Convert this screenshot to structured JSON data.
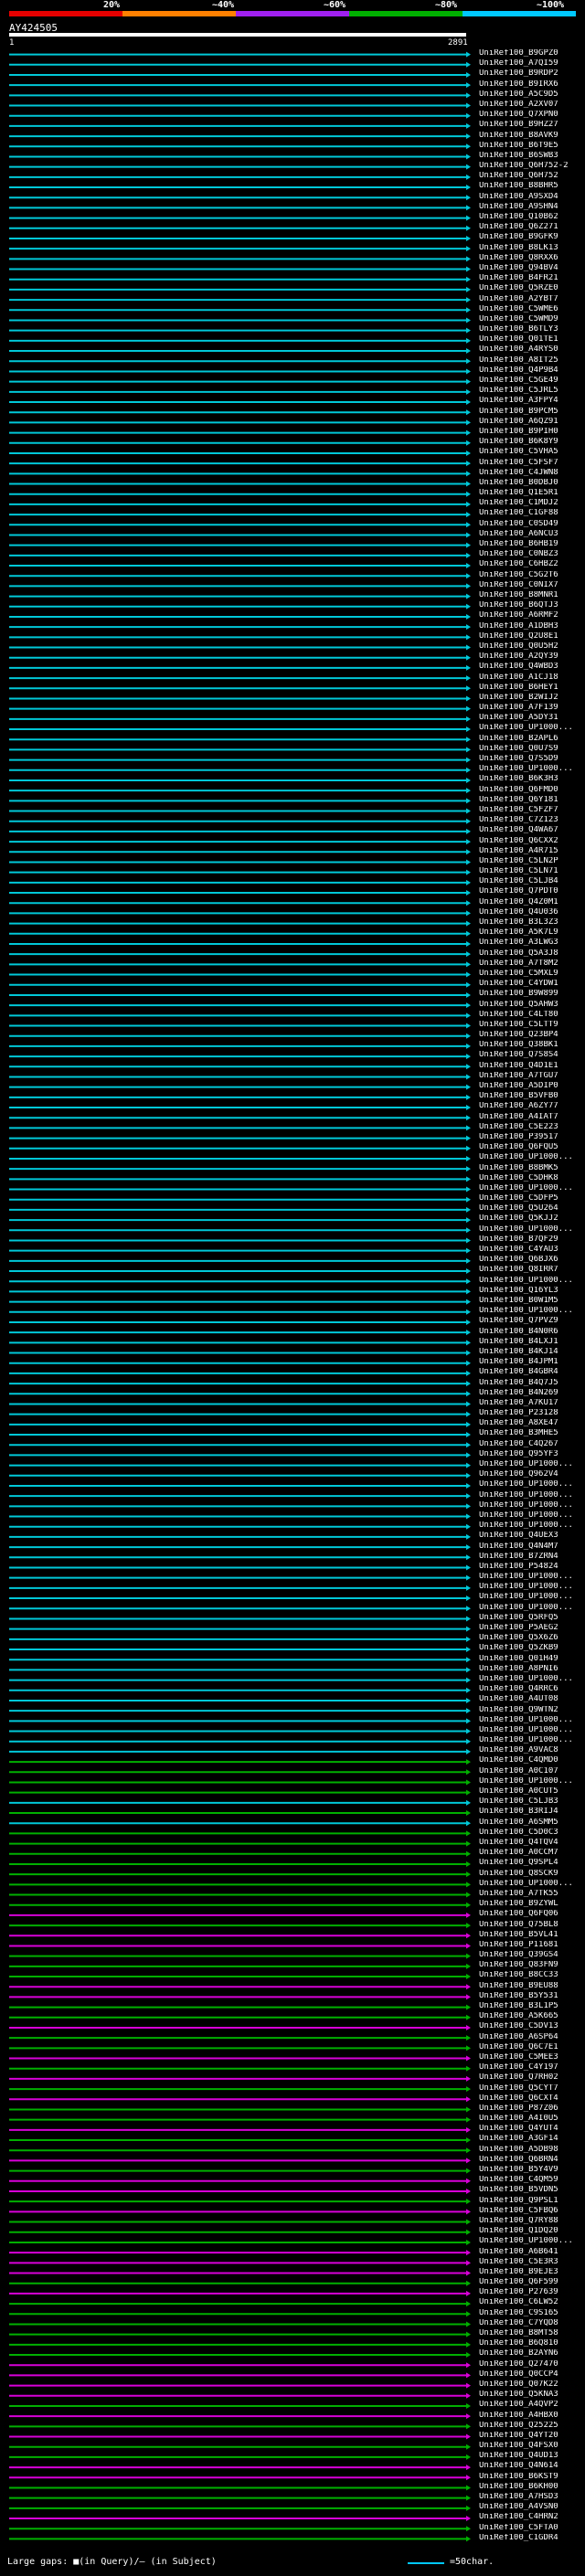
{
  "legend": {
    "percent_labels": [
      "20%",
      "~40%",
      "~60%",
      "~80%",
      "~100%"
    ],
    "colors": [
      "#e60000",
      "#ff8000",
      "#a020f0",
      "#00b000",
      "#00c8ff"
    ]
  },
  "query": {
    "id": "AY424505",
    "ruler_start": "1",
    "ruler_end": "2891"
  },
  "footer": {
    "gaps_text": "Large gaps: ■(in Query)/– (in Subject)",
    "scale_text": "=50char."
  },
  "hit_colors": {
    "cyan": "#00c8d8",
    "green": "#00b000",
    "magenta": "#d800d8"
  },
  "hits": [
    {
      "label": "UniRef100_B9GPZ0",
      "color": "cyan"
    },
    {
      "label": "UniRef100_A7QI59",
      "color": "cyan"
    },
    {
      "label": "UniRef100_B9RDP2",
      "color": "cyan"
    },
    {
      "label": "UniRef100_B9IRX6",
      "color": "cyan"
    },
    {
      "label": "UniRef100_A5C9D5",
      "color": "cyan"
    },
    {
      "label": "UniRef100_A2XV07",
      "color": "cyan"
    },
    {
      "label": "UniRef100_Q7XPN0",
      "color": "cyan"
    },
    {
      "label": "UniRef100_B9HZ27",
      "color": "cyan"
    },
    {
      "label": "UniRef100_B8AVK9",
      "color": "cyan"
    },
    {
      "label": "UniRef100_B6T9E5",
      "color": "cyan"
    },
    {
      "label": "UniRef100_B6SWB3",
      "color": "cyan"
    },
    {
      "label": "UniRef100_Q6H752-2",
      "color": "cyan"
    },
    {
      "label": "UniRef100_Q6H752",
      "color": "cyan"
    },
    {
      "label": "UniRef100_B8BHR5",
      "color": "cyan"
    },
    {
      "label": "UniRef100_A9SXD4",
      "color": "cyan"
    },
    {
      "label": "UniRef100_A9SHN4",
      "color": "cyan"
    },
    {
      "label": "UniRef100_Q10B62",
      "color": "cyan"
    },
    {
      "label": "UniRef100_Q6Z271",
      "color": "cyan"
    },
    {
      "label": "UniRef100_B9GFK9",
      "color": "cyan"
    },
    {
      "label": "UniRef100_B8LK13",
      "color": "cyan"
    },
    {
      "label": "UniRef100_Q8RXX6",
      "color": "cyan"
    },
    {
      "label": "UniRef100_Q94BV4",
      "color": "cyan"
    },
    {
      "label": "UniRef100_B4FR21",
      "color": "cyan"
    },
    {
      "label": "UniRef100_Q5RZE0",
      "color": "cyan"
    },
    {
      "label": "UniRef100_A2YBT7",
      "color": "cyan"
    },
    {
      "label": "UniRef100_C5WME6",
      "color": "cyan"
    },
    {
      "label": "UniRef100_C5WMD9",
      "color": "cyan"
    },
    {
      "label": "UniRef100_B6TLY3",
      "color": "cyan"
    },
    {
      "label": "UniRef100_Q01TE1",
      "color": "cyan"
    },
    {
      "label": "UniRef100_A4RYS0",
      "color": "cyan"
    },
    {
      "label": "UniRef100_A8IT25",
      "color": "cyan"
    },
    {
      "label": "UniRef100_Q4P9B4",
      "color": "cyan"
    },
    {
      "label": "UniRef100_C5GE49",
      "color": "cyan"
    },
    {
      "label": "UniRef100_C5JRL5",
      "color": "cyan"
    },
    {
      "label": "UniRef100_A3FPY4",
      "color": "cyan"
    },
    {
      "label": "UniRef100_B9PCM5",
      "color": "cyan"
    },
    {
      "label": "UniRef100_A6QZ91",
      "color": "cyan"
    },
    {
      "label": "UniRef100_B9PIH0",
      "color": "cyan"
    },
    {
      "label": "UniRef100_B6K8Y9",
      "color": "cyan"
    },
    {
      "label": "UniRef100_C5VHA5",
      "color": "cyan"
    },
    {
      "label": "UniRef100_C5FSF7",
      "color": "cyan"
    },
    {
      "label": "UniRef100_C4JWN8",
      "color": "cyan"
    },
    {
      "label": "UniRef100_B0DBJ0",
      "color": "cyan"
    },
    {
      "label": "UniRef100_Q1E5R1",
      "color": "cyan"
    },
    {
      "label": "UniRef100_C1MDJ2",
      "color": "cyan"
    },
    {
      "label": "UniRef100_C1GF88",
      "color": "cyan"
    },
    {
      "label": "UniRef100_C0SD49",
      "color": "cyan"
    },
    {
      "label": "UniRef100_A6NCU3",
      "color": "cyan"
    },
    {
      "label": "UniRef100_B6HB19",
      "color": "cyan"
    },
    {
      "label": "UniRef100_C0NBZ3",
      "color": "cyan"
    },
    {
      "label": "UniRef100_C6HBZ2",
      "color": "cyan"
    },
    {
      "label": "UniRef100_C5G2T6",
      "color": "cyan"
    },
    {
      "label": "UniRef100_C0NIX7",
      "color": "cyan"
    },
    {
      "label": "UniRef100_B8MNR1",
      "color": "cyan"
    },
    {
      "label": "UniRef100_B6QTJ3",
      "color": "cyan"
    },
    {
      "label": "UniRef100_A6RMF2",
      "color": "cyan"
    },
    {
      "label": "UniRef100_A1DBH3",
      "color": "cyan"
    },
    {
      "label": "UniRef100_Q2U8E1",
      "color": "cyan"
    },
    {
      "label": "UniRef100_Q0U5H2",
      "color": "cyan"
    },
    {
      "label": "UniRef100_A2QY39",
      "color": "cyan"
    },
    {
      "label": "UniRef100_Q4WBD3",
      "color": "cyan"
    },
    {
      "label": "UniRef100_A1CJ18",
      "color": "cyan"
    },
    {
      "label": "UniRef100_B6HEY1",
      "color": "cyan"
    },
    {
      "label": "UniRef100_B2WIJ2",
      "color": "cyan"
    },
    {
      "label": "UniRef100_A7F139",
      "color": "cyan"
    },
    {
      "label": "UniRef100_A5DY31",
      "color": "cyan"
    },
    {
      "label": "UniRef100_UP1000...",
      "color": "cyan"
    },
    {
      "label": "UniRef100_B2APL6",
      "color": "cyan"
    },
    {
      "label": "UniRef100_Q0U7S9",
      "color": "cyan"
    },
    {
      "label": "UniRef100_Q7S5D9",
      "color": "cyan"
    },
    {
      "label": "UniRef100_UP1000...",
      "color": "cyan"
    },
    {
      "label": "UniRef100_B6K3H3",
      "color": "cyan"
    },
    {
      "label": "UniRef100_Q6FMD0",
      "color": "cyan"
    },
    {
      "label": "UniRef100_Q6Y181",
      "color": "cyan"
    },
    {
      "label": "UniRef100_C5FZF7",
      "color": "cyan"
    },
    {
      "label": "UniRef100_C7Z123",
      "color": "cyan"
    },
    {
      "label": "UniRef100_Q4WA67",
      "color": "cyan"
    },
    {
      "label": "UniRef100_Q6CXX2",
      "color": "cyan"
    },
    {
      "label": "UniRef100_A4R715",
      "color": "cyan"
    },
    {
      "label": "UniRef100_C5LN2P",
      "color": "cyan"
    },
    {
      "label": "UniRef100_C5LN71",
      "color": "cyan"
    },
    {
      "label": "UniRef100_C5LJB4",
      "color": "cyan"
    },
    {
      "label": "UniRef100_Q7PDT0",
      "color": "cyan"
    },
    {
      "label": "UniRef100_Q4Z0M1",
      "color": "cyan"
    },
    {
      "label": "UniRef100_Q4U036",
      "color": "cyan"
    },
    {
      "label": "UniRef100_B3L3Z3",
      "color": "cyan"
    },
    {
      "label": "UniRef100_A5K7L9",
      "color": "cyan"
    },
    {
      "label": "UniRef100_A3LWG3",
      "color": "cyan"
    },
    {
      "label": "UniRef100_Q5A3J8",
      "color": "cyan"
    },
    {
      "label": "UniRef100_A7T8M2",
      "color": "cyan"
    },
    {
      "label": "UniRef100_C5MXL9",
      "color": "cyan"
    },
    {
      "label": "UniRef100_C4YDW1",
      "color": "cyan"
    },
    {
      "label": "UniRef100_B9W899",
      "color": "cyan"
    },
    {
      "label": "UniRef100_Q5AHW3",
      "color": "cyan"
    },
    {
      "label": "UniRef100_C4LT80",
      "color": "cyan"
    },
    {
      "label": "UniRef100_C5LTT9",
      "color": "cyan"
    },
    {
      "label": "UniRef100_Q23BP4",
      "color": "cyan"
    },
    {
      "label": "UniRef100_Q38BK1",
      "color": "cyan"
    },
    {
      "label": "UniRef100_Q7S8S4",
      "color": "cyan"
    },
    {
      "label": "UniRef100_Q4D1E1",
      "color": "cyan"
    },
    {
      "label": "UniRef100_A7TGU7",
      "color": "cyan"
    },
    {
      "label": "UniRef100_A5DIP0",
      "color": "cyan"
    },
    {
      "label": "UniRef100_B5VFB0",
      "color": "cyan"
    },
    {
      "label": "UniRef100_A6ZY77",
      "color": "cyan"
    },
    {
      "label": "UniRef100_A4IAT7",
      "color": "cyan"
    },
    {
      "label": "UniRef100_C5E223",
      "color": "cyan"
    },
    {
      "label": "UniRef100_P39517",
      "color": "cyan"
    },
    {
      "label": "UniRef100_Q6FQU5",
      "color": "cyan"
    },
    {
      "label": "UniRef100_UP1000...",
      "color": "cyan"
    },
    {
      "label": "UniRef100_B8BMK5",
      "color": "cyan"
    },
    {
      "label": "UniRef100_C5DHK8",
      "color": "cyan"
    },
    {
      "label": "UniRef100_UP1000...",
      "color": "cyan"
    },
    {
      "label": "UniRef100_C5DFP5",
      "color": "cyan"
    },
    {
      "label": "UniRef100_Q5U264",
      "color": "cyan"
    },
    {
      "label": "UniRef100_Q5KJJ2",
      "color": "cyan"
    },
    {
      "label": "UniRef100_UP1000...",
      "color": "cyan"
    },
    {
      "label": "UniRef100_B7QF29",
      "color": "cyan"
    },
    {
      "label": "UniRef100_C4YAU3",
      "color": "cyan"
    },
    {
      "label": "UniRef100_Q6BJX6",
      "color": "cyan"
    },
    {
      "label": "UniRef100_Q8IRR7",
      "color": "cyan"
    },
    {
      "label": "UniRef100_UP1000...",
      "color": "cyan"
    },
    {
      "label": "UniRef100_Q16YL3",
      "color": "cyan"
    },
    {
      "label": "UniRef100_B0W1M5",
      "color": "cyan"
    },
    {
      "label": "UniRef100_UP1000...",
      "color": "cyan"
    },
    {
      "label": "UniRef100_Q7PVZ9",
      "color": "cyan"
    },
    {
      "label": "UniRef100_B4N0R6",
      "color": "cyan"
    },
    {
      "label": "UniRef100_B4LXJ1",
      "color": "cyan"
    },
    {
      "label": "UniRef100_B4KJ14",
      "color": "cyan"
    },
    {
      "label": "UniRef100_B4JPM1",
      "color": "cyan"
    },
    {
      "label": "UniRef100_B4GBR4",
      "color": "cyan"
    },
    {
      "label": "UniRef100_B4Q7J5",
      "color": "cyan"
    },
    {
      "label": "UniRef100_B4N269",
      "color": "cyan"
    },
    {
      "label": "UniRef100_A7KU17",
      "color": "cyan"
    },
    {
      "label": "UniRef100_P23128",
      "color": "cyan"
    },
    {
      "label": "UniRef100_A8XE47",
      "color": "cyan"
    },
    {
      "label": "UniRef100_B3MHE5",
      "color": "cyan"
    },
    {
      "label": "UniRef100_C4Q267",
      "color": "cyan"
    },
    {
      "label": "UniRef100_Q95YF3",
      "color": "cyan"
    },
    {
      "label": "UniRef100_UP1000...",
      "color": "cyan"
    },
    {
      "label": "UniRef100_Q962V4",
      "color": "cyan"
    },
    {
      "label": "UniRef100_UP1000...",
      "color": "cyan"
    },
    {
      "label": "UniRef100_UP1000...",
      "color": "cyan"
    },
    {
      "label": "UniRef100_UP1000...",
      "color": "cyan"
    },
    {
      "label": "UniRef100_UP1000...",
      "color": "cyan"
    },
    {
      "label": "UniRef100_UP1000...",
      "color": "cyan"
    },
    {
      "label": "UniRef100_Q4UEX3",
      "color": "cyan"
    },
    {
      "label": "UniRef100_Q4N4M7",
      "color": "cyan"
    },
    {
      "label": "UniRef100_B7ZRN4",
      "color": "cyan"
    },
    {
      "label": "UniRef100_P54824",
      "color": "cyan"
    },
    {
      "label": "UniRef100_UP1000...",
      "color": "cyan"
    },
    {
      "label": "UniRef100_UP1000...",
      "color": "cyan"
    },
    {
      "label": "UniRef100_UP1000...",
      "color": "cyan"
    },
    {
      "label": "UniRef100_UP1000...",
      "color": "cyan"
    },
    {
      "label": "UniRef100_Q5RFQ5",
      "color": "cyan"
    },
    {
      "label": "UniRef100_P5AEG2",
      "color": "cyan"
    },
    {
      "label": "UniRef100_Q5X6Z6",
      "color": "cyan"
    },
    {
      "label": "UniRef100_Q5ZKB9",
      "color": "cyan"
    },
    {
      "label": "UniRef100_Q01H49",
      "color": "cyan"
    },
    {
      "label": "UniRef100_A8PNI6",
      "color": "cyan"
    },
    {
      "label": "UniRef100_UP1000...",
      "color": "cyan"
    },
    {
      "label": "UniRef100_Q4RRC6",
      "color": "cyan"
    },
    {
      "label": "UniRef100_A4UT08",
      "color": "cyan"
    },
    {
      "label": "UniRef100_Q9WTN2",
      "color": "cyan"
    },
    {
      "label": "UniRef100_UP1000...",
      "color": "cyan"
    },
    {
      "label": "UniRef100_UP1000...",
      "color": "cyan"
    },
    {
      "label": "UniRef100_UP1000...",
      "color": "cyan"
    },
    {
      "label": "UniRef100_A9VAC8",
      "color": "cyan"
    },
    {
      "label": "UniRef100_C4QMD0",
      "color": "green"
    },
    {
      "label": "UniRef100_A0C107",
      "color": "green"
    },
    {
      "label": "UniRef100_UP1000...",
      "color": "green"
    },
    {
      "label": "UniRef100_A0CUT5",
      "color": "green"
    },
    {
      "label": "UniRef100_C5LJB3",
      "color": "cyan"
    },
    {
      "label": "UniRef100_B3RIJ4",
      "color": "green"
    },
    {
      "label": "UniRef100_A6SMM5",
      "color": "cyan"
    },
    {
      "label": "UniRef100_C5D0C3",
      "color": "green"
    },
    {
      "label": "UniRef100_Q4TQV4",
      "color": "green"
    },
    {
      "label": "UniRef100_A0CCM7",
      "color": "green"
    },
    {
      "label": "UniRef100_Q9SPL4",
      "color": "green"
    },
    {
      "label": "UniRef100_Q8SCK9",
      "color": "green"
    },
    {
      "label": "UniRef100_UP1000...",
      "color": "green"
    },
    {
      "label": "UniRef100_A7TK55",
      "color": "green"
    },
    {
      "label": "UniRef100_B9ZYWL",
      "color": "green"
    },
    {
      "label": "UniRef100_Q6FQ06",
      "color": "magenta"
    },
    {
      "label": "UniRef100_Q75BL8",
      "color": "green"
    },
    {
      "label": "UniRef100_B5VL41",
      "color": "magenta"
    },
    {
      "label": "UniRef100_P11681",
      "color": "magenta"
    },
    {
      "label": "UniRef100_Q39GS4",
      "color": "green"
    },
    {
      "label": "UniRef100_Q83FN9",
      "color": "green"
    },
    {
      "label": "UniRef100_B8CC33",
      "color": "green"
    },
    {
      "label": "UniRef100_B9EU88",
      "color": "magenta"
    },
    {
      "label": "UniRef100_B5Y531",
      "color": "magenta"
    },
    {
      "label": "UniRef100_B3L1P5",
      "color": "green"
    },
    {
      "label": "UniRef100_A5K665",
      "color": "green"
    },
    {
      "label": "UniRef100_C5DV13",
      "color": "magenta"
    },
    {
      "label": "UniRef100_A6SP64",
      "color": "green"
    },
    {
      "label": "UniRef100_Q6C7E1",
      "color": "green"
    },
    {
      "label": "UniRef100_C5MEE3",
      "color": "magenta"
    },
    {
      "label": "UniRef100_C4Y197",
      "color": "green"
    },
    {
      "label": "UniRef100_Q7RH02",
      "color": "magenta"
    },
    {
      "label": "UniRef100_Q5CYT7",
      "color": "green"
    },
    {
      "label": "UniRef100_Q6CXT4",
      "color": "magenta"
    },
    {
      "label": "UniRef100_P87Z06",
      "color": "green"
    },
    {
      "label": "UniRef100_A4I0U5",
      "color": "green"
    },
    {
      "label": "UniRef100_Q4YUT4",
      "color": "magenta"
    },
    {
      "label": "UniRef100_A3GF14",
      "color": "green"
    },
    {
      "label": "UniRef100_A5DB98",
      "color": "green"
    },
    {
      "label": "UniRef100_Q6BRN4",
      "color": "magenta"
    },
    {
      "label": "UniRef100_B5Y4V9",
      "color": "green"
    },
    {
      "label": "UniRef100_C4QM59",
      "color": "magenta"
    },
    {
      "label": "UniRef100_B5VDN5",
      "color": "magenta"
    },
    {
      "label": "UniRef100_Q9PSL1",
      "color": "green"
    },
    {
      "label": "UniRef100_C5FBQ6",
      "color": "magenta"
    },
    {
      "label": "UniRef100_Q7RY88",
      "color": "green"
    },
    {
      "label": "UniRef100_Q1DQ20",
      "color": "green"
    },
    {
      "label": "UniRef100_UP1000...",
      "color": "green"
    },
    {
      "label": "UniRef100_A6B641",
      "color": "magenta"
    },
    {
      "label": "UniRef100_C5E3R3",
      "color": "magenta"
    },
    {
      "label": "UniRef100_B9EJE3",
      "color": "magenta"
    },
    {
      "label": "UniRef100_Q6F599",
      "color": "green"
    },
    {
      "label": "UniRef100_P27639",
      "color": "magenta"
    },
    {
      "label": "UniRef100_C6LW52",
      "color": "green"
    },
    {
      "label": "UniRef100_C9S165",
      "color": "green"
    },
    {
      "label": "UniRef100_C7YQD8",
      "color": "green"
    },
    {
      "label": "UniRef100_B8MT58",
      "color": "green"
    },
    {
      "label": "UniRef100_B6Q810",
      "color": "green"
    },
    {
      "label": "UniRef100_B2AYN6",
      "color": "green"
    },
    {
      "label": "UniRef100_Q27470",
      "color": "magenta"
    },
    {
      "label": "UniRef100_Q0CCP4",
      "color": "magenta"
    },
    {
      "label": "UniRef100_Q07K22",
      "color": "magenta"
    },
    {
      "label": "UniRef100_Q5KNA3",
      "color": "magenta"
    },
    {
      "label": "UniRef100_A4QVP2",
      "color": "green"
    },
    {
      "label": "UniRef100_A4HBX0",
      "color": "magenta"
    },
    {
      "label": "UniRef100_Q25225",
      "color": "green"
    },
    {
      "label": "UniRef100_Q4YT20",
      "color": "magenta"
    },
    {
      "label": "UniRef100_Q4FSX0",
      "color": "green"
    },
    {
      "label": "UniRef100_Q4UD13",
      "color": "green"
    },
    {
      "label": "UniRef100_Q4N614",
      "color": "magenta"
    },
    {
      "label": "UniRef100_B6KST9",
      "color": "magenta"
    },
    {
      "label": "UniRef100_B6KH00",
      "color": "green"
    },
    {
      "label": "UniRef100_A7HSD3",
      "color": "green"
    },
    {
      "label": "UniRef100_A4VSN0",
      "color": "green"
    },
    {
      "label": "UniRef100_C4HRN2",
      "color": "magenta"
    },
    {
      "label": "UniRef100_C5FTA0",
      "color": "green"
    },
    {
      "label": "UniRef100_C1GDR4",
      "color": "green"
    }
  ]
}
